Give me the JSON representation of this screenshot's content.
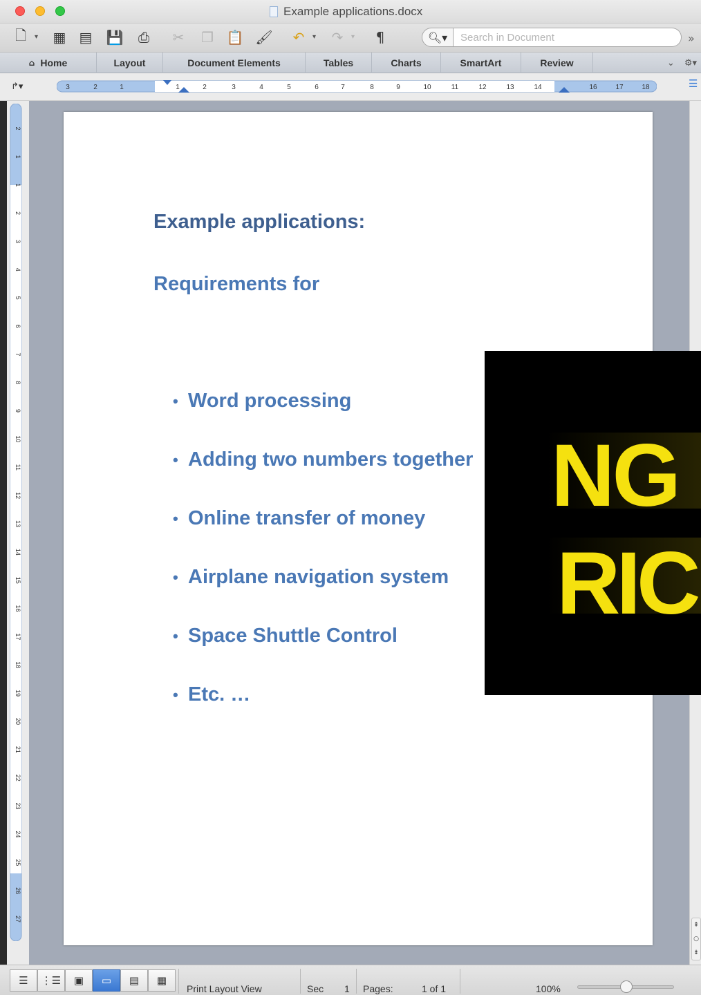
{
  "window": {
    "title": "Example applications.docx"
  },
  "toolbar": {
    "icons": [
      "new-document-icon",
      "templates-icon",
      "open-icon",
      "save-icon",
      "print-icon",
      "cut-icon",
      "copy-icon",
      "paste-icon",
      "format-painter-icon",
      "undo-icon",
      "redo-icon",
      "pilcrow-icon"
    ],
    "search_placeholder": "Search in Document"
  },
  "ribbon": {
    "tabs": [
      {
        "label": "Home"
      },
      {
        "label": "Layout"
      },
      {
        "label": "Document Elements"
      },
      {
        "label": "Tables"
      },
      {
        "label": "Charts"
      },
      {
        "label": "SmartArt"
      },
      {
        "label": "Review"
      }
    ]
  },
  "ruler": {
    "h_labels": [
      "3",
      "2",
      "1",
      "1",
      "2",
      "3",
      "4",
      "5",
      "6",
      "7",
      "8",
      "9",
      "10",
      "11",
      "12",
      "13",
      "14",
      "16",
      "17",
      "18"
    ],
    "v_labels": [
      "2",
      "1",
      "1",
      "2",
      "3",
      "4",
      "5",
      "6",
      "7",
      "8",
      "9",
      "10",
      "11",
      "12",
      "13",
      "14",
      "15",
      "16",
      "17",
      "18",
      "19",
      "20",
      "21",
      "22",
      "23",
      "24",
      "25",
      "26",
      "27"
    ]
  },
  "document": {
    "heading": "Example applications:",
    "subheading": "Requirements for",
    "bullets": [
      "Word processing",
      "Adding two numbers together",
      "Online transfer of money",
      "Airplane navigation system",
      "Space Shuttle Control",
      "Etc. …"
    ],
    "text_color": "#4a78b5"
  },
  "overlay": {
    "lines": [
      "NG",
      "RIC"
    ],
    "background": "#000000",
    "text_color": "#f5e10f"
  },
  "status": {
    "view": "Print Layout View",
    "sec_label": "Sec",
    "sec_value": "1",
    "pages_label": "Pages:",
    "pages_value": "1 of 1",
    "zoom": "100%"
  }
}
